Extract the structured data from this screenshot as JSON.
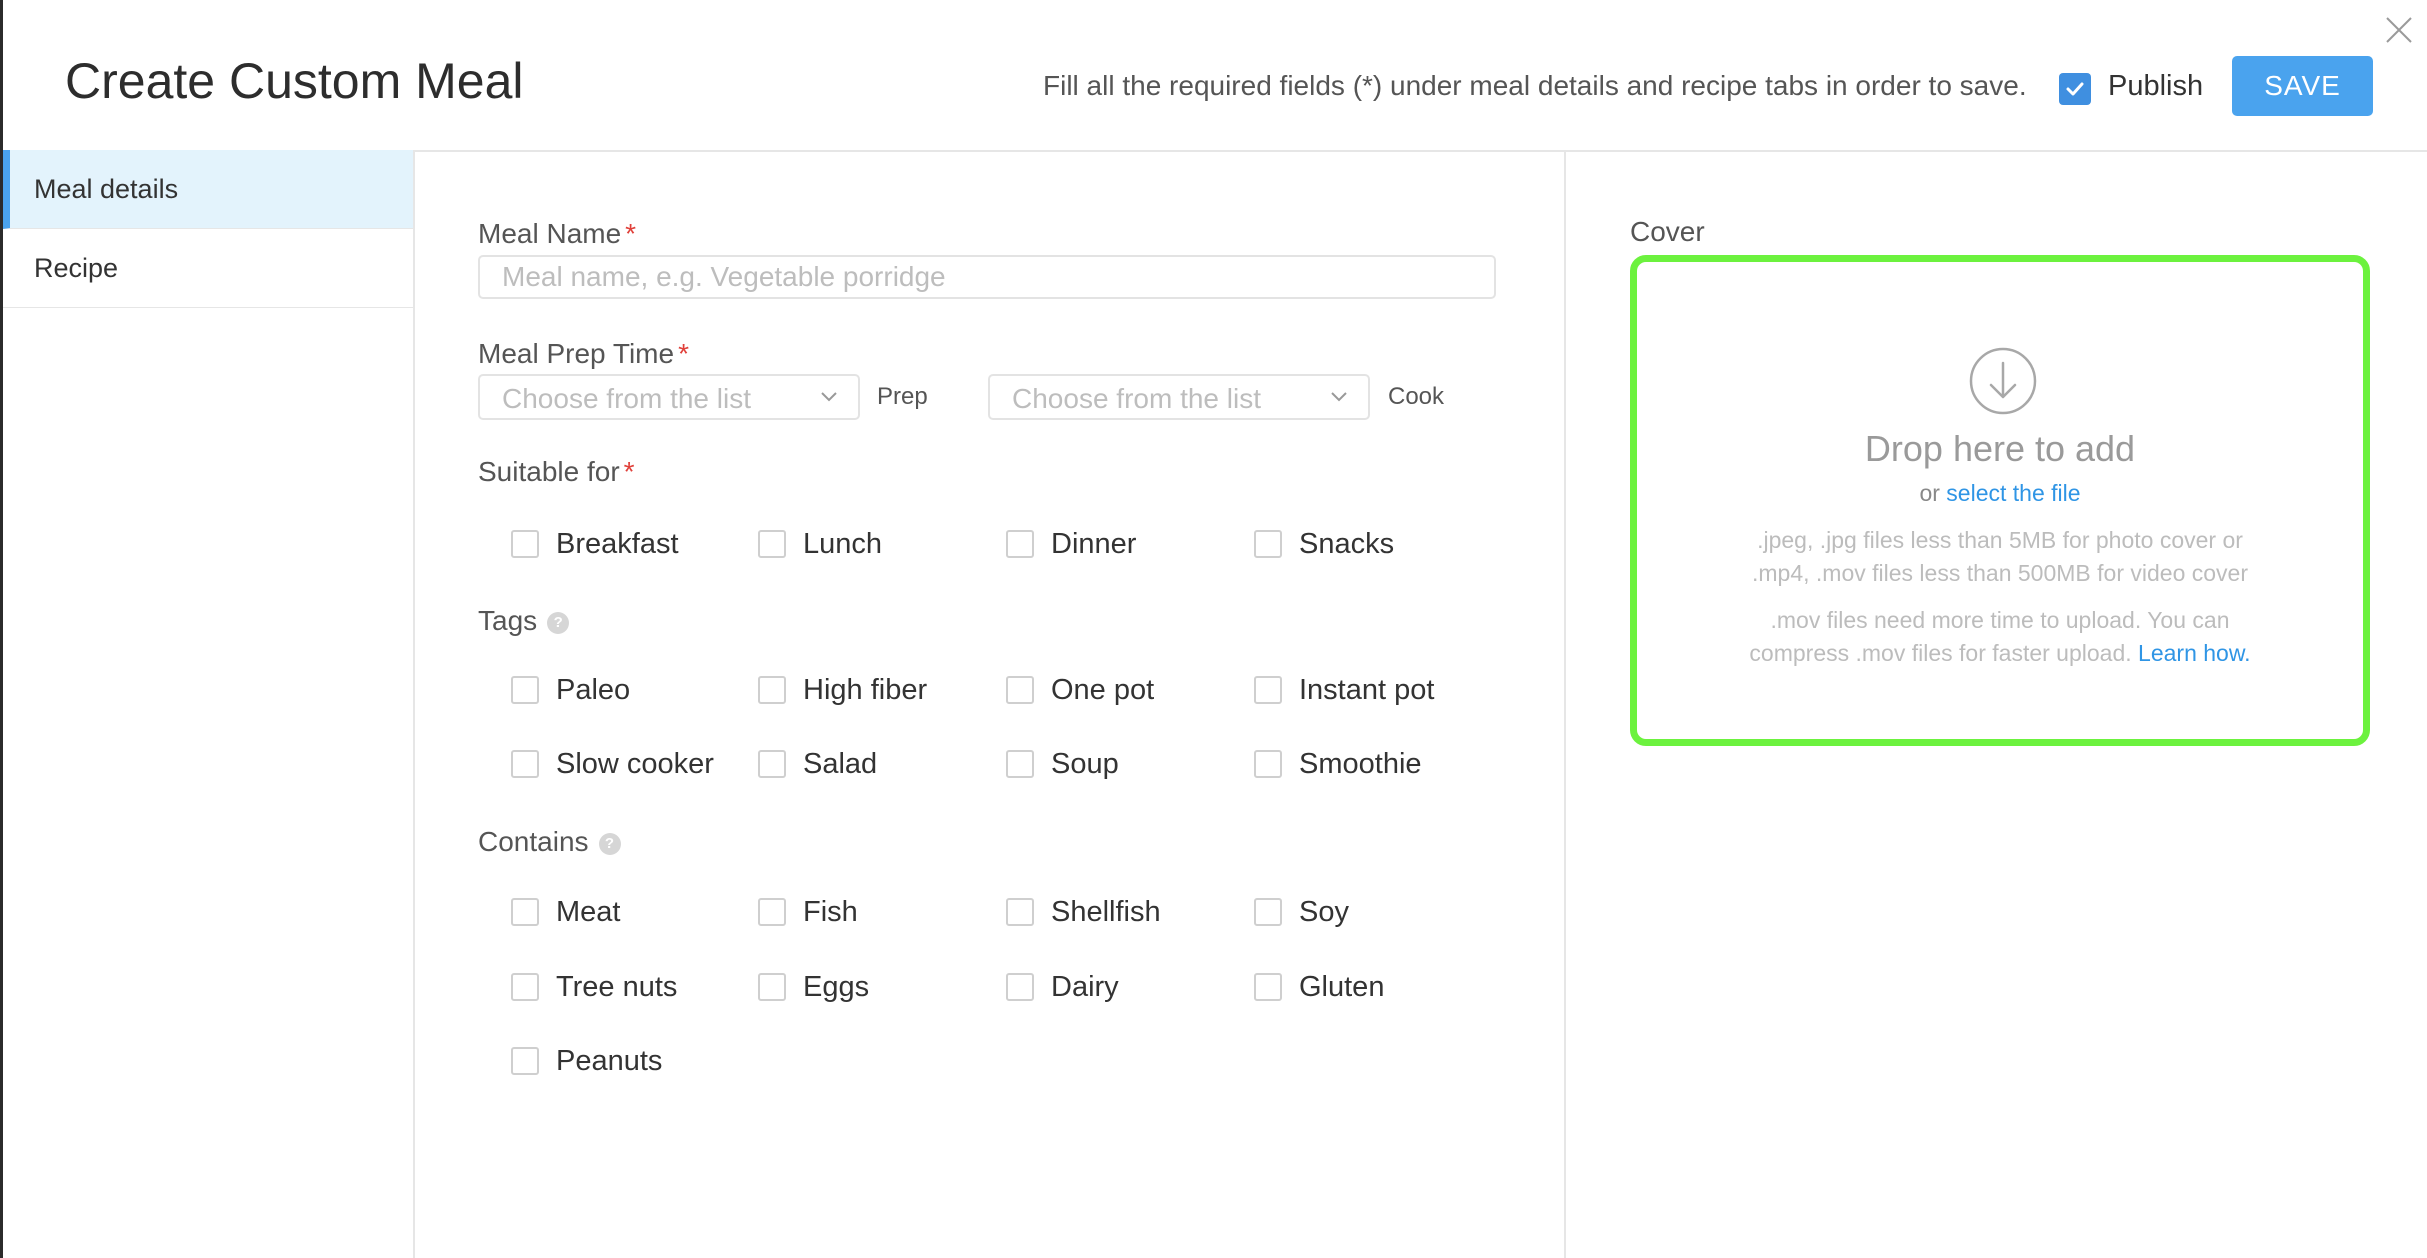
{
  "header": {
    "title": "Create Custom Meal",
    "instructions": "Fill all the required fields (*) under meal details and recipe tabs in order to save.",
    "publish_label": "Publish",
    "publish_checked": true,
    "save_label": "SAVE",
    "close_icon": "close-icon"
  },
  "sidebar": {
    "items": [
      {
        "label": "Meal details",
        "active": true
      },
      {
        "label": "Recipe",
        "active": false
      }
    ]
  },
  "form": {
    "meal_name": {
      "label": "Meal Name",
      "required": "*",
      "placeholder": "Meal name, e.g. Vegetable porridge",
      "value": ""
    },
    "prep_time": {
      "label": "Meal Prep Time",
      "required": "*",
      "prep_select": {
        "placeholder": "Choose from the list",
        "suffix": "Prep"
      },
      "cook_select": {
        "placeholder": "Choose from the list",
        "suffix": "Cook"
      }
    },
    "suitable_for": {
      "label": "Suitable for",
      "required": "*",
      "options": [
        "Breakfast",
        "Lunch",
        "Dinner",
        "Snacks"
      ]
    },
    "tags": {
      "label": "Tags",
      "help_icon": "?",
      "options": [
        "Paleo",
        "High fiber",
        "One pot",
        "Instant pot",
        "Slow cooker",
        "Salad",
        "Soup",
        "Smoothie"
      ]
    },
    "contains": {
      "label": "Contains",
      "help_icon": "?",
      "options": [
        "Meat",
        "Fish",
        "Shellfish",
        "Soy",
        "Tree nuts",
        "Eggs",
        "Dairy",
        "Gluten",
        "Peanuts"
      ]
    }
  },
  "cover": {
    "label": "Cover",
    "drop_title": "Drop here to add",
    "or_text": "or",
    "select_link": "select the file",
    "note_line1": ".jpeg, .jpg files less than 5MB for photo cover or",
    "note_line2": ".mp4, .mov files less than 500MB for video cover",
    "note_line3": ".mov files need more time to upload. You can",
    "note_line4": "compress .mov files for faster upload.",
    "learn_link": "Learn how.",
    "highlight_color": "#6cf23e"
  }
}
